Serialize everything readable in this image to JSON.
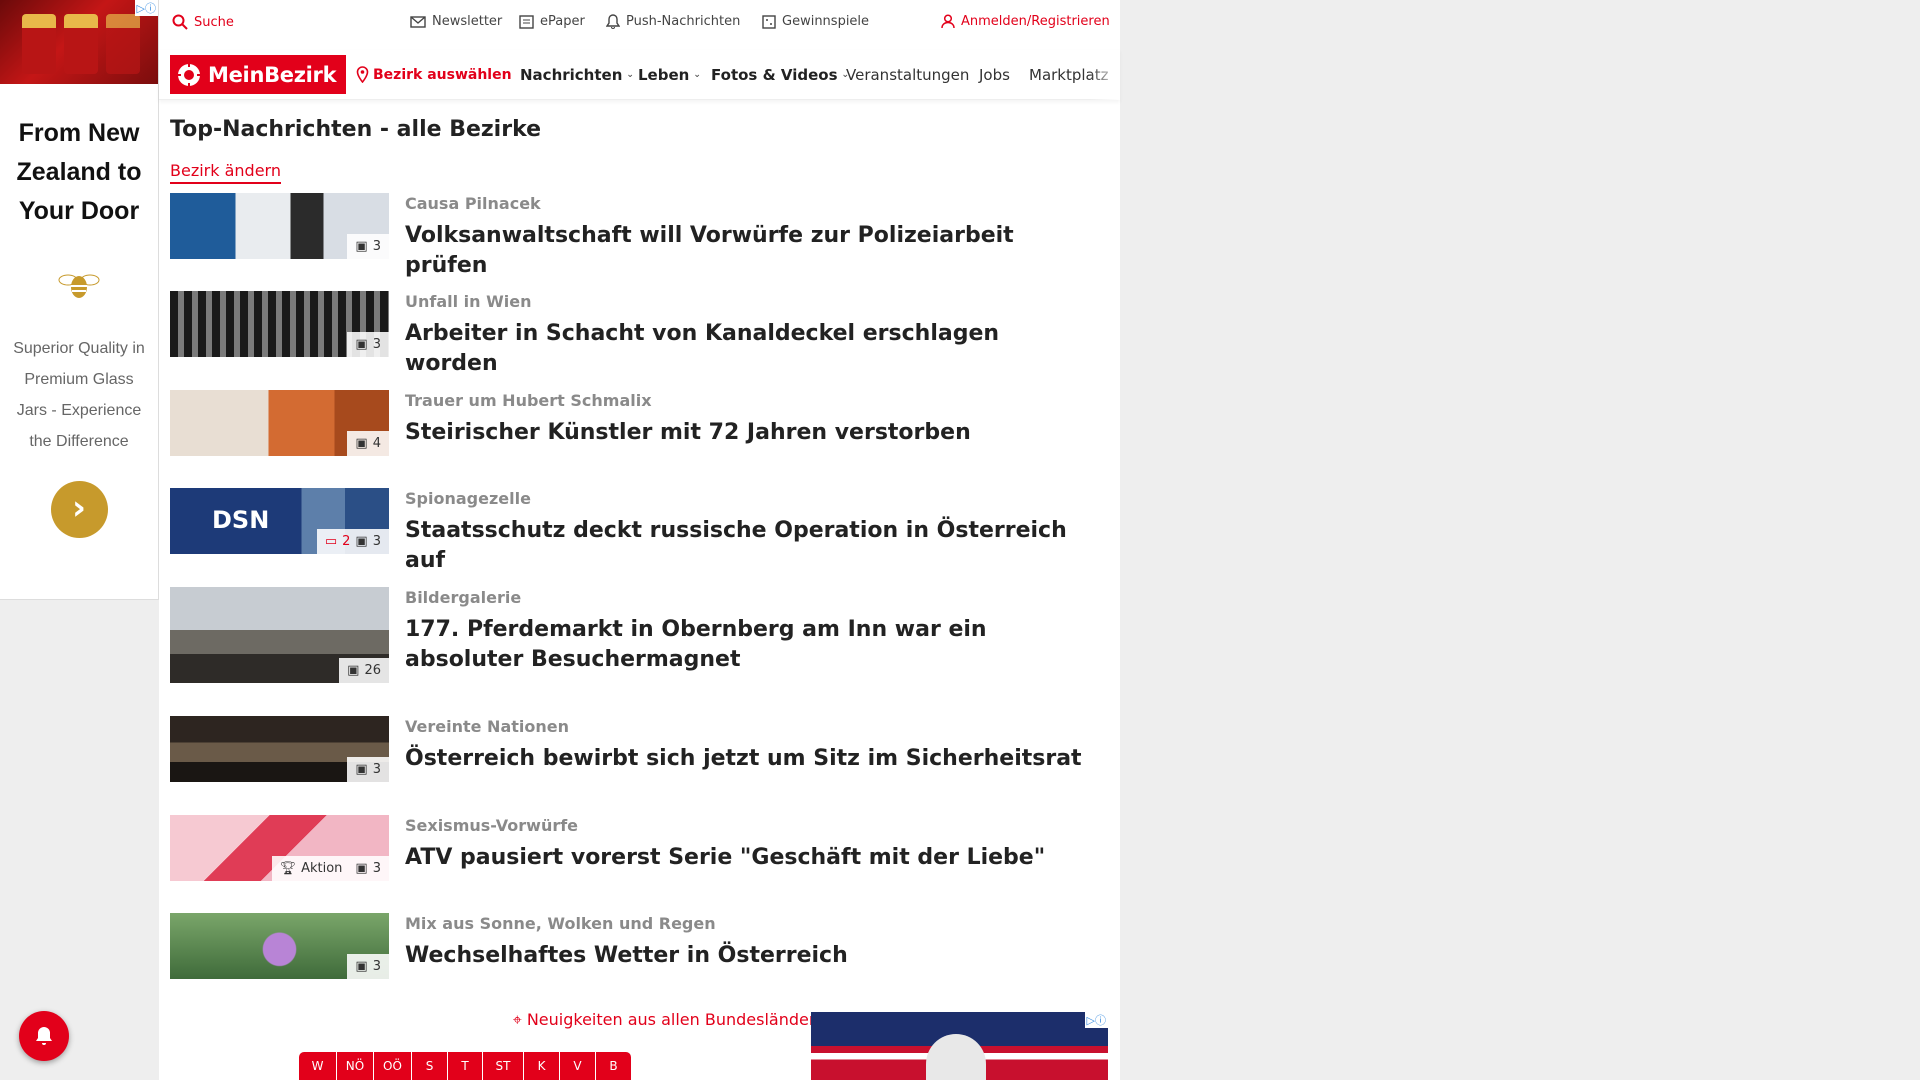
{
  "left_ad": {
    "adchoices": "▷ⓘ",
    "headline": "From New Zealand to Your Door",
    "subtext": "Superior Quality in Premium Glass Jars - Experience the Difference",
    "arrow": "›"
  },
  "utility": {
    "search": "Suche",
    "newsletter": "Newsletter",
    "epaper": "ePaper",
    "push": "Push-Nachrichten",
    "contests": "Gewinnspiele",
    "login": "Anmelden/Registrieren"
  },
  "nav": {
    "logo": "MeinBezirk",
    "district": "Bezirk auswählen",
    "news": "Nachrichten",
    "life": "Leben",
    "media": "Fotos & Videos",
    "events": "Veranstaltungen",
    "jobs": "Jobs",
    "market": "Marktplatz"
  },
  "section": {
    "title": "Top-Nachrichten - alle Bezirke",
    "change": "Bezirk ändern"
  },
  "articles": [
    {
      "kicker": "Causa Pilnacek",
      "headline": "Volksanwaltschaft will Vorwürfe zur Polizeiarbeit prüfen",
      "images": "3"
    },
    {
      "kicker": "Unfall in Wien",
      "headline": "Arbeiter in Schacht von Kanaldeckel erschlagen worden",
      "images": "3"
    },
    {
      "kicker": "Trauer um Hubert Schmalix",
      "headline": "Steirischer Künstler mit 72 Jahren verstorben",
      "images": "4"
    },
    {
      "kicker": "Spionagezelle",
      "headline": "Staatsschutz deckt russische Operation in Österreich auf",
      "images": "3",
      "comments": "2",
      "thumb_text": "DSN"
    },
    {
      "kicker": "Bildergalerie",
      "headline": "177. Pferdemarkt in Obernberg am Inn war ein absoluter Besuchermagnet",
      "images": "26"
    },
    {
      "kicker": "Vereinte Nationen",
      "headline": "Österreich bewirbt sich jetzt um Sitz im Sicherheitsrat",
      "images": "3"
    },
    {
      "kicker": "Sexismus-Vorwürfe",
      "headline": "ATV pausiert vorerst Serie \"Geschäft mit der Liebe\"",
      "images": "3",
      "action": "Aktion"
    },
    {
      "kicker": "Mix aus Sonne, Wolken und Regen",
      "headline": "Wechselhaftes Wetter in Österreich",
      "images": "3"
    }
  ],
  "regions": {
    "title": "Neuigkeiten aus allen Bundesländern",
    "states": [
      "W",
      "NÖ",
      "OÖ",
      "S",
      "T",
      "ST",
      "K",
      "V",
      "B"
    ]
  },
  "bottom_ad": {
    "adchoices": "▷ⓘ"
  }
}
